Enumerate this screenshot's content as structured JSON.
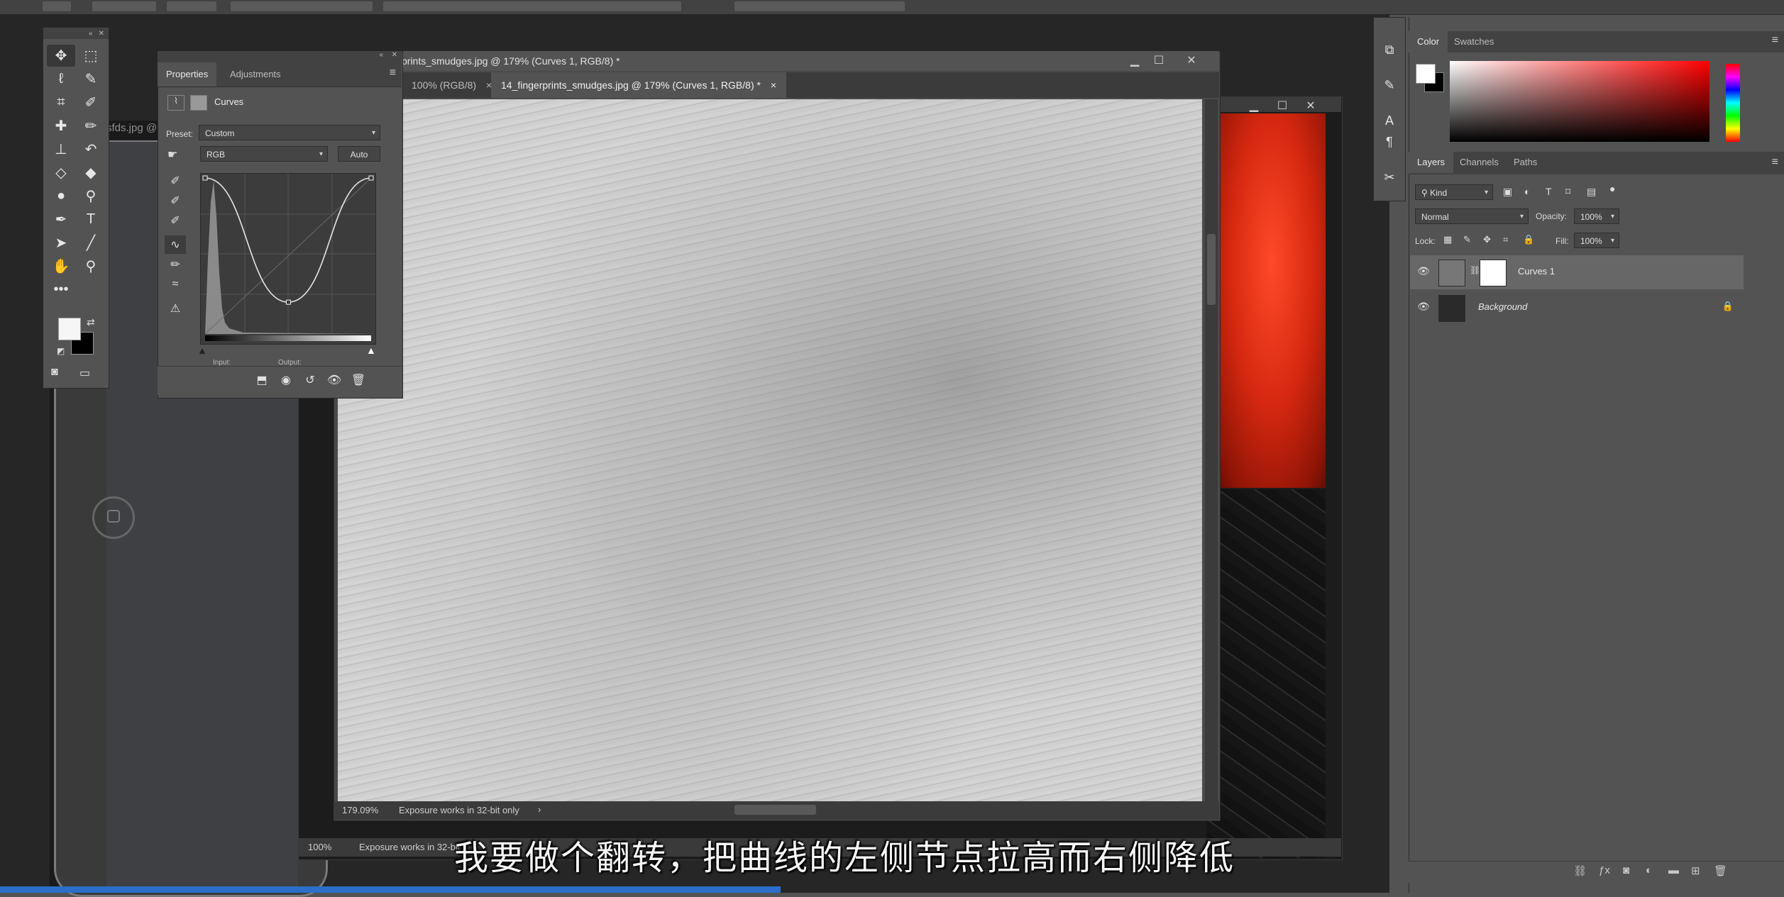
{
  "tools_panel": {
    "tools": [
      {
        "icon": "move-tool-icon"
      },
      {
        "icon": "marquee-tool-icon"
      },
      {
        "icon": "lasso-tool-icon"
      },
      {
        "icon": "quick-select-tool-icon"
      },
      {
        "icon": "crop-tool-icon"
      },
      {
        "icon": "eyedropper-tool-icon"
      },
      {
        "icon": "healing-brush-icon"
      },
      {
        "icon": "brush-tool-icon"
      },
      {
        "icon": "clone-stamp-icon"
      },
      {
        "icon": "history-brush-icon"
      },
      {
        "icon": "eraser-tool-icon"
      },
      {
        "icon": "paint-bucket-icon"
      },
      {
        "icon": "blur-tool-icon"
      },
      {
        "icon": "dodge-tool-icon"
      },
      {
        "icon": "pen-tool-icon"
      },
      {
        "icon": "type-tool-icon"
      },
      {
        "icon": "path-select-icon"
      },
      {
        "icon": "line-tool-icon"
      },
      {
        "icon": "hand-tool-icon"
      },
      {
        "icon": "zoom-tool-icon"
      }
    ],
    "more": "•••",
    "type_glyph": "T"
  },
  "background_doc": {
    "tab_label": "sfds.jpg @"
  },
  "middle_doc": {
    "tab_label": "100% (RGB/8)",
    "status_zoom": "100%",
    "status_text": "Exposure works in 32-bit"
  },
  "main_doc": {
    "title": "prints_smudges.jpg @ 179% (Curves 1, RGB/8) *",
    "tabs": [
      {
        "label": "100% (RGB/8)"
      },
      {
        "label": "14_fingerprints_smudges.jpg @ 179% (Curves 1, RGB/8) *"
      }
    ],
    "status_zoom": "179.09%",
    "status_text": "Exposure works in 32-bit only"
  },
  "properties": {
    "tabs": [
      "Properties",
      "Adjustments"
    ],
    "section_title": "Curves",
    "preset_label": "Preset:",
    "preset_value": "Custom",
    "channel_value": "RGB",
    "auto_label": "Auto",
    "input_label": "Input:",
    "output_label": "Output:",
    "curve": {
      "points": [
        [
          0,
          255
        ],
        [
          128,
          52
        ],
        [
          255,
          255
        ]
      ]
    }
  },
  "color_panel": {
    "tabs": [
      "Color",
      "Swatches"
    ],
    "fg": "#ffffff",
    "bg": "#000000",
    "hue": "#ff0000"
  },
  "layers_panel": {
    "tabs": [
      "Layers",
      "Channels",
      "Paths"
    ],
    "filter_value": "Kind",
    "blend_mode": "Normal",
    "opacity_label": "Opacity:",
    "opacity_value": "100%",
    "lock_label": "Lock:",
    "fill_label": "Fill:",
    "fill_value": "100%",
    "layers": [
      {
        "name": "Curves 1",
        "selected": true
      },
      {
        "name": "Background",
        "selected": false
      }
    ]
  },
  "subtitle": "我要做个翻转，把曲线的左侧节点拉高而右侧降低"
}
